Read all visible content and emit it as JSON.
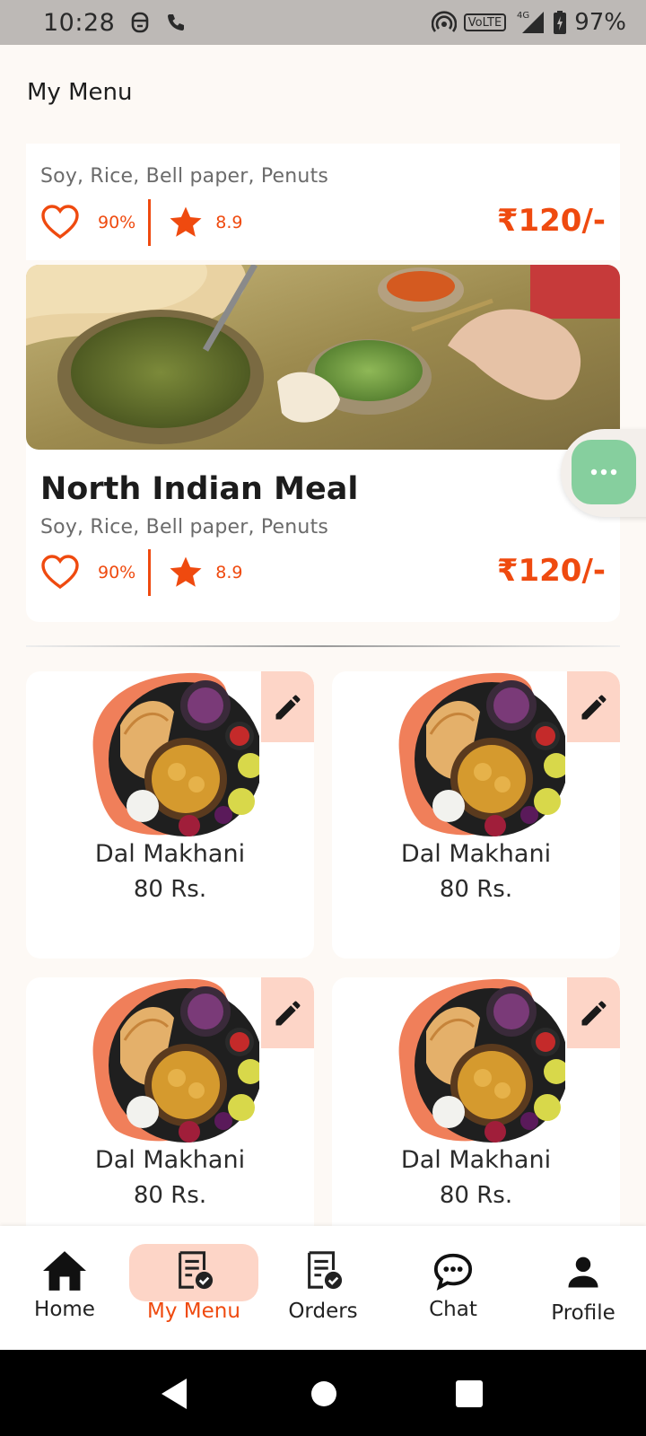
{
  "status_bar": {
    "time": "10:28",
    "battery": "97%",
    "network": "4G",
    "volte": "VoLTE"
  },
  "page": {
    "title": "My Menu"
  },
  "top_card": {
    "ingredients": "Soy,  Rice, Bell paper, Penuts",
    "like_percent": "90%",
    "rating": "8.9",
    "price": "₹120/-"
  },
  "main_card": {
    "title": "North Indian Meal",
    "ingredients": "Soy,  Rice, Bell paper, Penuts",
    "like_percent": "90%",
    "rating": "8.9",
    "price": "₹120/-"
  },
  "menu_items": [
    {
      "name": "Dal Makhani",
      "price": "80 Rs."
    },
    {
      "name": "Dal Makhani",
      "price": "80 Rs."
    },
    {
      "name": "Dal Makhani",
      "price": "80 Rs."
    },
    {
      "name": "Dal Makhani",
      "price": "80 Rs."
    }
  ],
  "bottom_nav": {
    "items": [
      {
        "label": "Home",
        "icon": "home-icon"
      },
      {
        "label": "My Menu",
        "icon": "menu-list-icon",
        "active": true
      },
      {
        "label": "Orders",
        "icon": "orders-icon"
      },
      {
        "label": "Chat",
        "icon": "chat-icon"
      },
      {
        "label": "Profile",
        "icon": "profile-icon"
      }
    ]
  },
  "colors": {
    "accent": "#ef4a0f",
    "accent_light": "#fdd5c7",
    "fab": "#86cf9e",
    "background": "#fdf9f5"
  }
}
